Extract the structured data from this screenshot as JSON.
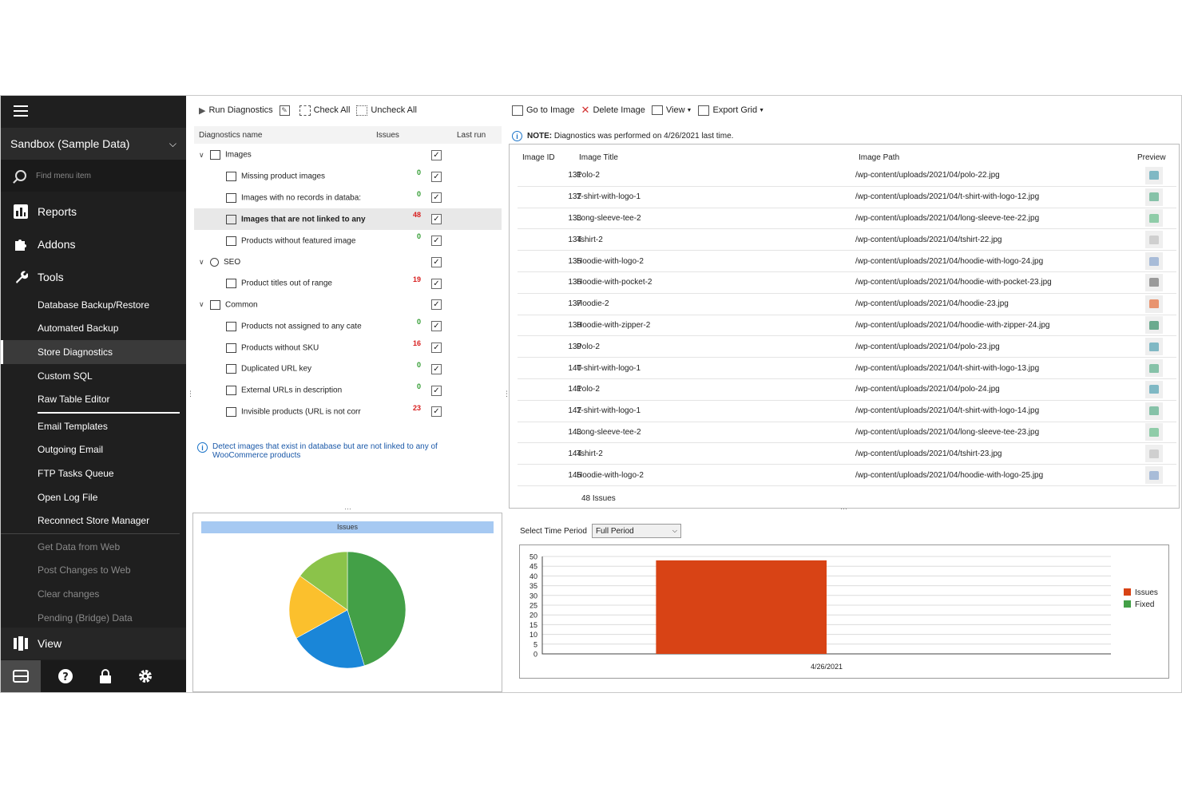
{
  "sidebar": {
    "store": "Sandbox (Sample Data)",
    "find_placeholder": "Find menu item",
    "top_items": [
      "Reports",
      "Addons",
      "Tools"
    ],
    "tools": [
      {
        "label": "Database Backup/Restore",
        "state": "normal"
      },
      {
        "label": "Automated Backup",
        "state": "normal"
      },
      {
        "label": "Store Diagnostics",
        "state": "active"
      },
      {
        "label": "Custom SQL",
        "state": "normal"
      },
      {
        "label": "Raw Table Editor",
        "state": "normal"
      }
    ],
    "tools2": [
      "Email Templates",
      "Outgoing Email",
      "FTP Tasks Queue",
      "Open Log File",
      "Reconnect Store Manager"
    ],
    "tools3": [
      "Get Data from Web",
      "Post Changes to Web",
      "Clear changes",
      "Pending (Bridge) Data"
    ],
    "view": "View"
  },
  "diag": {
    "toolbar": {
      "run": "Run Diagnostics",
      "check_all": "Check All",
      "uncheck_all": "Uncheck All"
    },
    "headers": {
      "name": "Diagnostics name",
      "issues": "Issues",
      "last_run": "Last run"
    },
    "rows": [
      {
        "label": "Images",
        "level": 0,
        "count": "",
        "color": ""
      },
      {
        "label": "Missing product images",
        "level": 1,
        "count": "0",
        "color": "g"
      },
      {
        "label": "Images with no records in databa:",
        "level": 1,
        "count": "0",
        "color": "g"
      },
      {
        "label": "Images that are not linked to any",
        "level": 1,
        "count": "48",
        "color": "r",
        "selected": true
      },
      {
        "label": "Products without featured image",
        "level": 1,
        "count": "0",
        "color": "g"
      },
      {
        "label": "SEO",
        "level": 0,
        "count": "",
        "color": ""
      },
      {
        "label": "Product titles out of range",
        "level": 1,
        "count": "19",
        "color": "r"
      },
      {
        "label": "Common",
        "level": 0,
        "count": "",
        "color": ""
      },
      {
        "label": "Products not assigned to any cate",
        "level": 1,
        "count": "0",
        "color": "g"
      },
      {
        "label": "Products without SKU",
        "level": 1,
        "count": "16",
        "color": "r"
      },
      {
        "label": "Duplicated URL key",
        "level": 1,
        "count": "0",
        "color": "g"
      },
      {
        "label": "External URLs in description",
        "level": 1,
        "count": "0",
        "color": "g"
      },
      {
        "label": "Invisible products (URL is not corr",
        "level": 1,
        "count": "23",
        "color": "r"
      }
    ],
    "description": "Detect images that exist in database but are not linked to any of WooCommerce products"
  },
  "grid": {
    "toolbar": {
      "goto": "Go to Image",
      "delete": "Delete Image",
      "view": "View",
      "export": "Export Grid"
    },
    "note_bold": "NOTE:",
    "note_text": "Diagnostics was performed on 4/26/2021 last time.",
    "headers": {
      "id": "Image ID",
      "title": "Image Title",
      "path": "Image Path",
      "preview": "Preview"
    },
    "rows": [
      {
        "id": "131",
        "title": "Polo-2",
        "path": "/wp-content/uploads/2021/04/polo-22.jpg",
        "color": "#7fb8c4"
      },
      {
        "id": "132",
        "title": "T-shirt-with-logo-1",
        "path": "/wp-content/uploads/2021/04/t-shirt-with-logo-12.jpg",
        "color": "#86c2a8"
      },
      {
        "id": "133",
        "title": "Long-sleeve-tee-2",
        "path": "/wp-content/uploads/2021/04/long-sleeve-tee-22.jpg",
        "color": "#8fcca8"
      },
      {
        "id": "134",
        "title": "Tshirt-2",
        "path": "/wp-content/uploads/2021/04/tshirt-22.jpg",
        "color": "#cfcfcf"
      },
      {
        "id": "135",
        "title": "Hoodie-with-logo-2",
        "path": "/wp-content/uploads/2021/04/hoodie-with-logo-24.jpg",
        "color": "#a8bcd8"
      },
      {
        "id": "136",
        "title": "Hoodie-with-pocket-2",
        "path": "/wp-content/uploads/2021/04/hoodie-with-pocket-23.jpg",
        "color": "#9a9a9a"
      },
      {
        "id": "137",
        "title": "Hoodie-2",
        "path": "/wp-content/uploads/2021/04/hoodie-23.jpg",
        "color": "#e89470"
      },
      {
        "id": "138",
        "title": "Hoodie-with-zipper-2",
        "path": "/wp-content/uploads/2021/04/hoodie-with-zipper-24.jpg",
        "color": "#6aaa8e"
      },
      {
        "id": "139",
        "title": "Polo-2",
        "path": "/wp-content/uploads/2021/04/polo-23.jpg",
        "color": "#7fb8c4"
      },
      {
        "id": "140",
        "title": "T-shirt-with-logo-1",
        "path": "/wp-content/uploads/2021/04/t-shirt-with-logo-13.jpg",
        "color": "#86c2a8"
      },
      {
        "id": "141",
        "title": "Polo-2",
        "path": "/wp-content/uploads/2021/04/polo-24.jpg",
        "color": "#7fb8c4"
      },
      {
        "id": "142",
        "title": "T-shirt-with-logo-1",
        "path": "/wp-content/uploads/2021/04/t-shirt-with-logo-14.jpg",
        "color": "#86c2a8"
      },
      {
        "id": "143",
        "title": "Long-sleeve-tee-2",
        "path": "/wp-content/uploads/2021/04/long-sleeve-tee-23.jpg",
        "color": "#8fcca8"
      },
      {
        "id": "144",
        "title": "Tshirt-2",
        "path": "/wp-content/uploads/2021/04/tshirt-23.jpg",
        "color": "#cfcfcf"
      },
      {
        "id": "145",
        "title": "Hoodie-with-logo-2",
        "path": "/wp-content/uploads/2021/04/hoodie-with-logo-25.jpg",
        "color": "#a8bcd8"
      }
    ],
    "footer": "48 Issues"
  },
  "period": {
    "label": "Select Time Period",
    "value": "Full Period"
  },
  "chart_data": [
    {
      "type": "pie",
      "title": "Issues",
      "values": [
        48,
        23,
        19,
        16
      ],
      "colors": [
        "#43a047",
        "#1a86d8",
        "#fbc02d",
        "#8bc34a"
      ]
    },
    {
      "type": "bar",
      "categories": [
        "4/26/2021"
      ],
      "series": [
        {
          "name": "Issues",
          "values": [
            48
          ],
          "color": "#d84315"
        },
        {
          "name": "Fixed",
          "values": [
            0
          ],
          "color": "#43a047"
        }
      ],
      "ylim": [
        0,
        50
      ],
      "yticks": [
        0,
        5,
        10,
        15,
        20,
        25,
        30,
        35,
        40,
        45,
        50
      ],
      "legend": "right",
      "grid": true
    }
  ]
}
